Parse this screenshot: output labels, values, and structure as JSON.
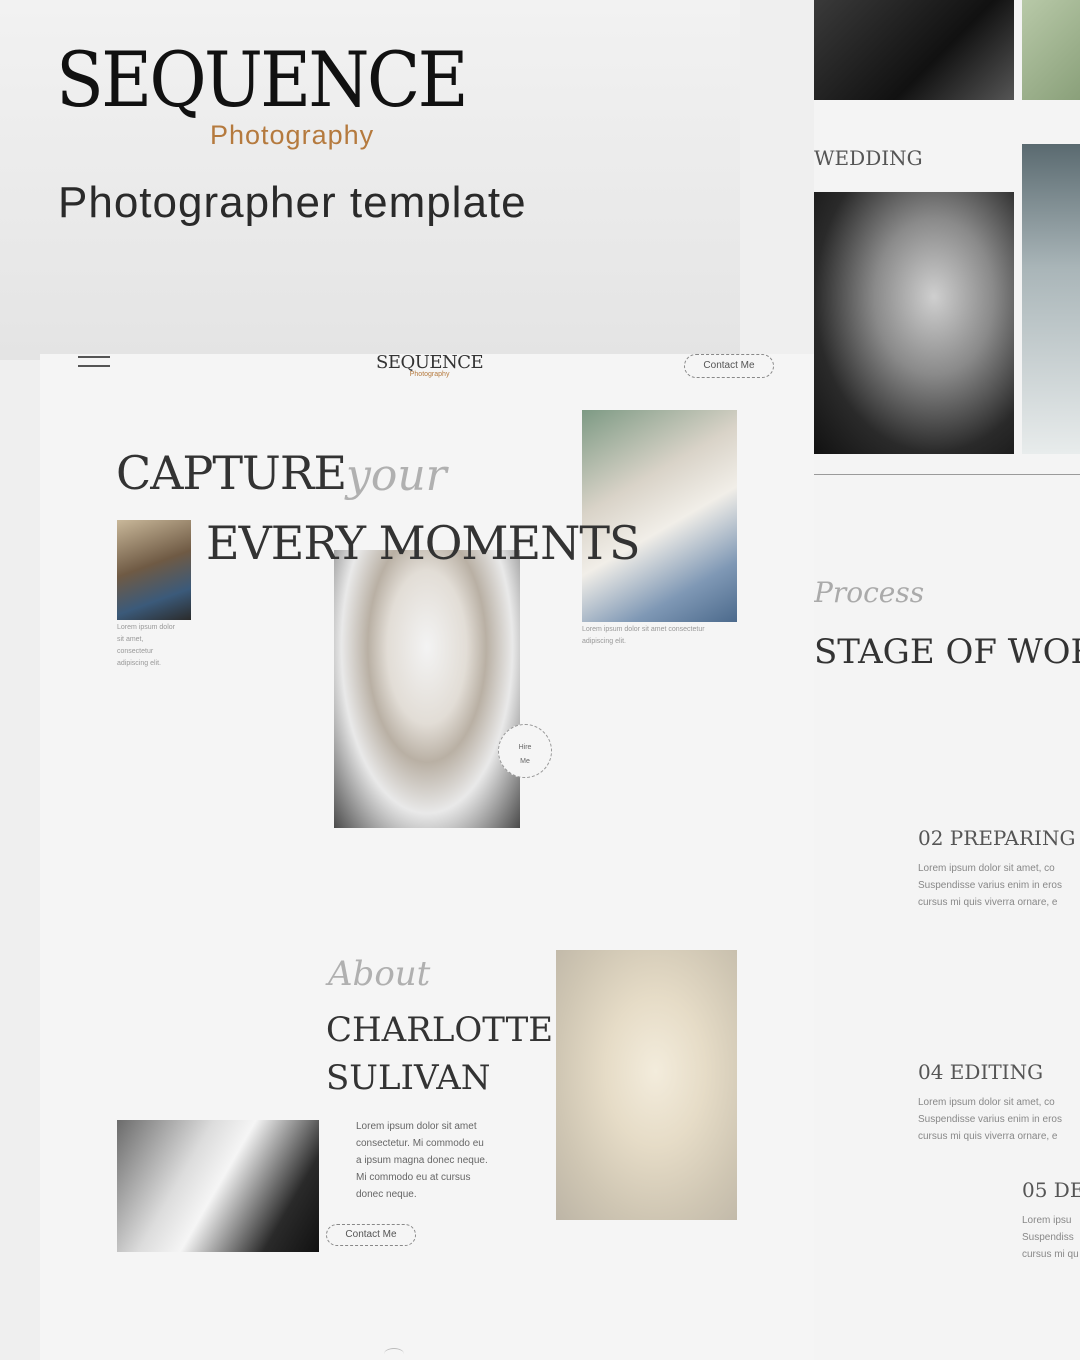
{
  "brand": {
    "title": "SEQUENCE",
    "subtitle": "Photography",
    "tagline": "Photographer template"
  },
  "main_page": {
    "logo_title": "SEQUENCE",
    "logo_sub": "Photography",
    "contact_label": "Contact Me",
    "hero_line1": "CAPTURE",
    "hero_script": "your",
    "hero_line2": "EVERY MOMENTS",
    "family_caption": [
      "Lorem ipsum dolor",
      "sit amet,",
      "consectetur",
      "adipiscing elit."
    ],
    "wedding_caption": [
      "Lorem ipsum dolor sit amet consectetur",
      "adipiscing elit."
    ],
    "badge_line1": "Hire",
    "badge_line2": "Me",
    "about_script": "About",
    "about_name_line1": "CHARLOTTE",
    "about_name_line2": "SULIVAN",
    "about_text": [
      "Lorem ipsum dolor sit amet",
      "consectetur. Mi commodo eu",
      "a ipsum magna donec neque.",
      "Mi commodo eu at cursus",
      "donec neque."
    ],
    "about_contact_label": "Contact Me"
  },
  "right_page": {
    "wedding_label": "WEDDING",
    "process_script": "Process",
    "process_heading": "STAGE OF WORK",
    "step1_title": "02 PREPARING",
    "step1_text": [
      "Lorem ipsum dolor sit amet, co",
      "Suspendisse varius enim in eros",
      "cursus mi quis viverra ornare, e"
    ],
    "step2_title": "04 EDITING",
    "step2_text": [
      "Lorem ipsum dolor sit amet, co",
      "Suspendisse varius enim in eros",
      "cursus mi quis viverra ornare, e"
    ],
    "step3_title": "05 DE",
    "step3_text": [
      "Lorem ipsu",
      "Suspendiss",
      "cursus mi qu"
    ]
  },
  "colors": {
    "accent": "#b57a3e",
    "text_dark": "#222222",
    "background": "#efefef"
  }
}
